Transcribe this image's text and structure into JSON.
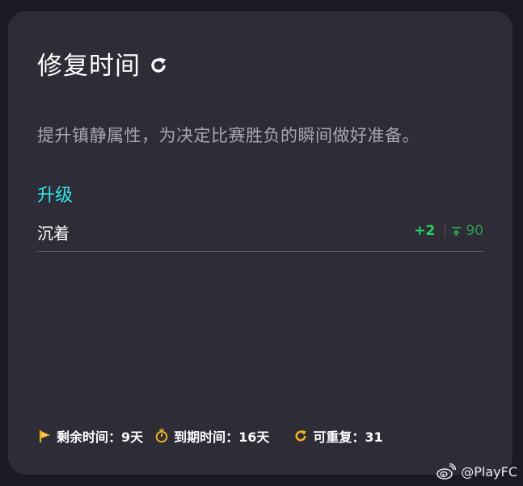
{
  "card": {
    "title": "修复时间",
    "description": "提升镇静属性，为决定比赛胜负的瞬间做好准备。",
    "section_label": "升级",
    "attribute": {
      "name": "沉着",
      "delta": "+2",
      "cap": "90"
    },
    "footer": {
      "remaining": "剩余时间：9天",
      "expires": "到期时间：16天",
      "repeatable": "可重复：31"
    }
  },
  "watermark": "@PlayFC",
  "colors": {
    "accent_cyan": "#2fe6e6",
    "delta_green": "#27d05b",
    "cap_green": "#2e9a50",
    "footer_icon_gold": "#f2b318"
  },
  "icons": [
    "refresh-icon",
    "cap-arrow-icon",
    "flag-icon",
    "stopwatch-icon",
    "repeat-icon",
    "weibo-icon"
  ]
}
